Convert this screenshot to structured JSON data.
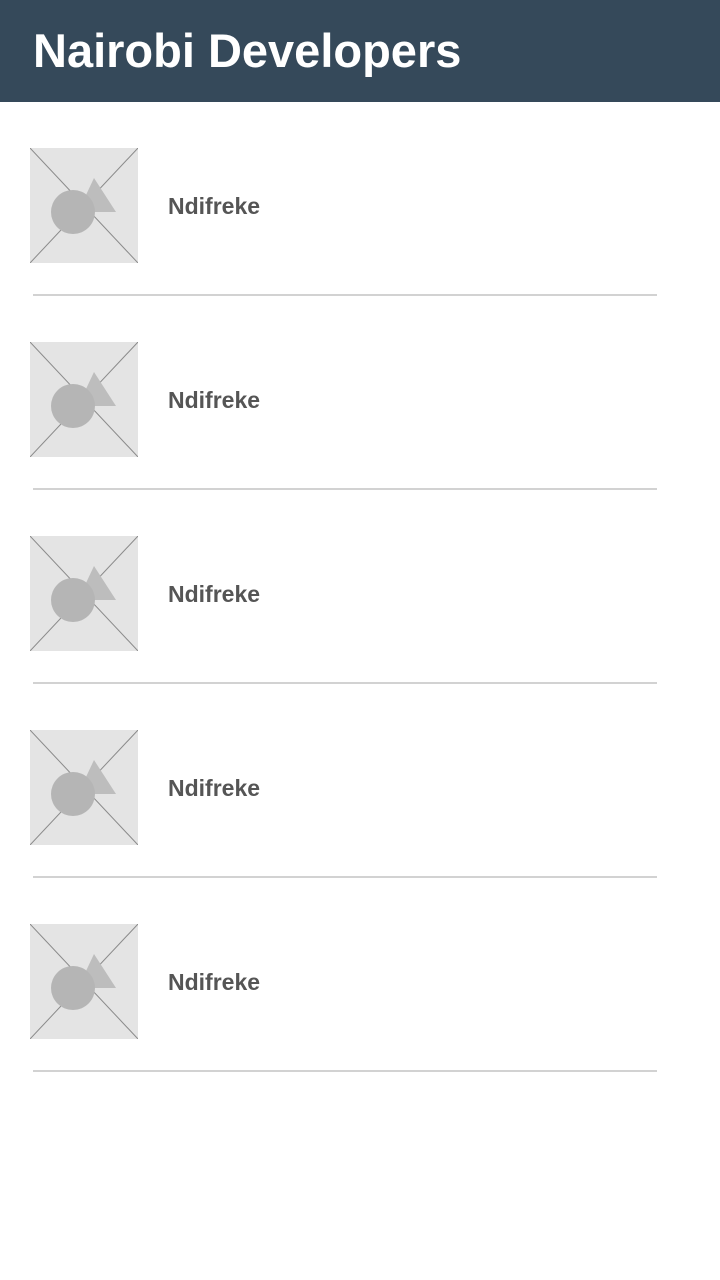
{
  "app": {
    "title": "Nairobi Developers",
    "header_color": "#35495a"
  },
  "developers": [
    {
      "name": "Ndifreke",
      "avatar_icon": "image-placeholder-icon"
    },
    {
      "name": "Ndifreke",
      "avatar_icon": "image-placeholder-icon"
    },
    {
      "name": "Ndifreke",
      "avatar_icon": "image-placeholder-icon"
    },
    {
      "name": "Ndifreke",
      "avatar_icon": "image-placeholder-icon"
    },
    {
      "name": "Ndifreke",
      "avatar_icon": "image-placeholder-icon"
    }
  ]
}
